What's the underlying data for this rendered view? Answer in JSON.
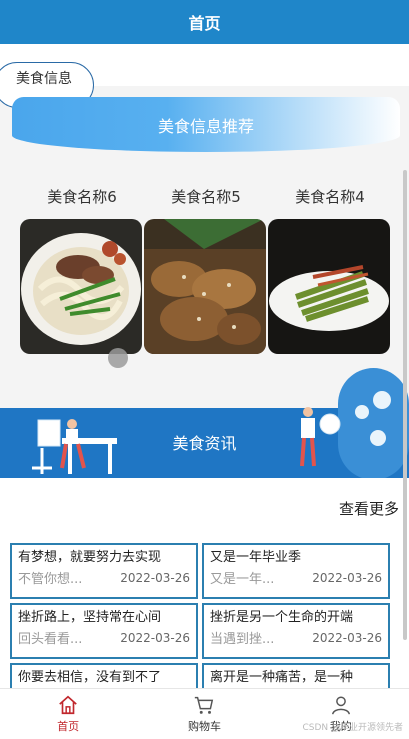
{
  "header": {
    "title": "首页"
  },
  "top_button": {
    "label": "美食信息"
  },
  "recommend": {
    "banner_title": "美食信息推荐",
    "items": [
      {
        "name": "美食名称6",
        "image": "noodles-beef"
      },
      {
        "name": "美食名称5",
        "image": "fried-food"
      },
      {
        "name": "美食名称4",
        "image": "green-beans"
      }
    ]
  },
  "news": {
    "section_title": "美食资讯",
    "more_label": "查看更多",
    "items": [
      {
        "title": "有梦想，就要努力去实现",
        "summary": "不管你想...",
        "date": "2022-03-26"
      },
      {
        "title": "又是一年毕业季",
        "summary": "又是一年...",
        "date": "2022-03-26"
      },
      {
        "title": "挫折路上，坚持常在心间",
        "summary": "回头看看...",
        "date": "2022-03-26"
      },
      {
        "title": "挫折是另一个生命的开端",
        "summary": "当遇到挫...",
        "date": "2022-03-26"
      },
      {
        "title": "你要去相信，没有到不了",
        "summary": "",
        "date": ""
      },
      {
        "title": "离开是一种痛苦，是一种",
        "summary": "",
        "date": ""
      }
    ]
  },
  "tabbar": {
    "items": [
      {
        "label": "首页",
        "icon": "home-icon",
        "active": true
      },
      {
        "label": "购物车",
        "icon": "cart-icon",
        "active": false
      },
      {
        "label": "我的",
        "icon": "user-icon",
        "active": false
      }
    ]
  },
  "watermark": "CSDN @毕业开源领先者",
  "colors": {
    "primary": "#1f86c9",
    "band": "#1f76c4",
    "active_tab": "#c1272d",
    "card_border": "#2b7fb0"
  }
}
